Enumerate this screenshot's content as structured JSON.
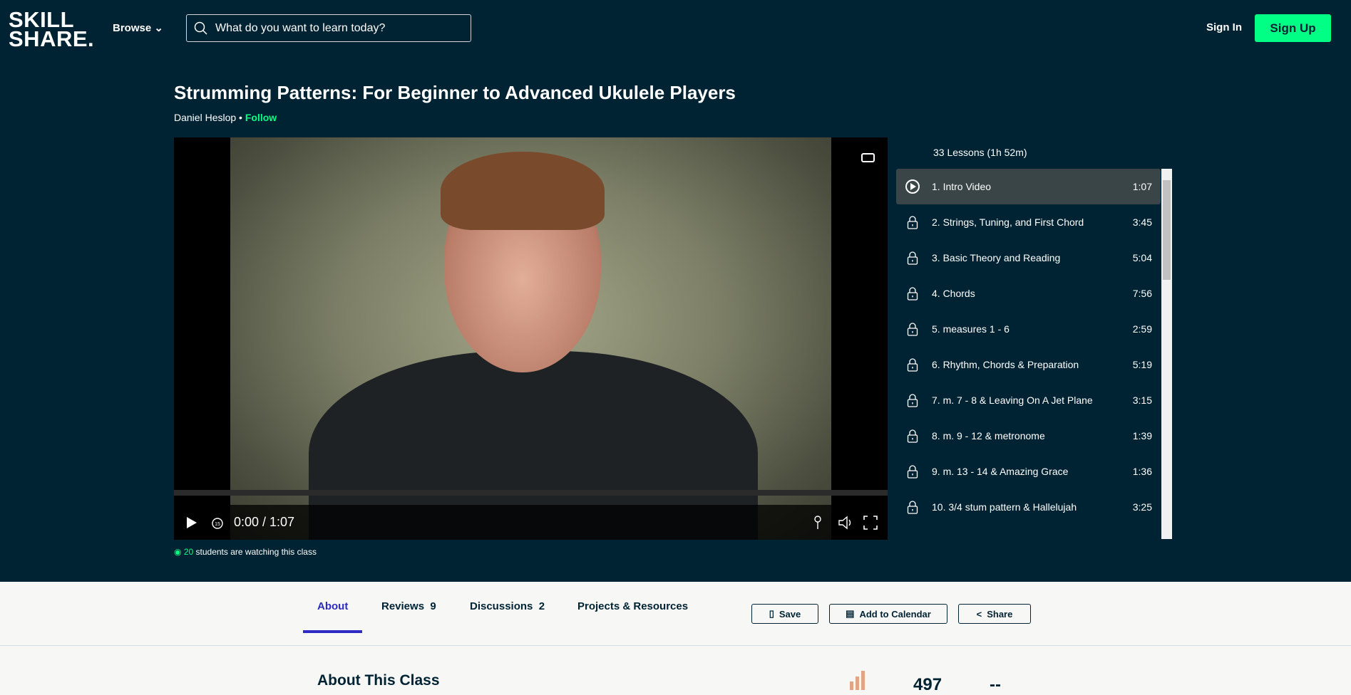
{
  "header": {
    "logo": "SKILL SHARE.",
    "browse": "Browse",
    "search_placeholder": "What do you want to learn today?",
    "sign_in": "Sign In",
    "sign_up": "Sign Up"
  },
  "course": {
    "title": "Strumming Patterns: For Beginner to Advanced Ukulele Players",
    "author": "Daniel Heslop",
    "follow": "Follow"
  },
  "player": {
    "time": "0:00 / 1:07"
  },
  "lessons": {
    "summary": "33 Lessons (1h 52m)",
    "items": [
      {
        "label": "1. Intro Video",
        "duration": "1:07",
        "icon": "play-circle-icon",
        "active": true
      },
      {
        "label": "2. Strings, Tuning, and First Chord",
        "duration": "3:45",
        "icon": "lock-icon"
      },
      {
        "label": "3. Basic Theory and Reading",
        "duration": "5:04",
        "icon": "lock-icon"
      },
      {
        "label": "4. Chords",
        "duration": "7:56",
        "icon": "lock-icon"
      },
      {
        "label": "5. measures 1 - 6",
        "duration": "2:59",
        "icon": "lock-icon"
      },
      {
        "label": "6. Rhythm, Chords & Preparation",
        "duration": "5:19",
        "icon": "lock-icon"
      },
      {
        "label": "7. m. 7 - 8 & Leaving On A Jet Plane",
        "duration": "3:15",
        "icon": "lock-icon"
      },
      {
        "label": "8. m. 9 - 12 & metronome",
        "duration": "1:39",
        "icon": "lock-icon"
      },
      {
        "label": "9. m. 13 - 14 & Amazing Grace",
        "duration": "1:36",
        "icon": "lock-icon"
      },
      {
        "label": "10. 3/4 stum pattern & Hallelujah",
        "duration": "3:25",
        "icon": "lock-icon"
      }
    ]
  },
  "watching": {
    "count": "20",
    "text": " students are watching this class"
  },
  "tabs": [
    {
      "label": "About"
    },
    {
      "label": "Reviews  9"
    },
    {
      "label": "Discussions  2"
    },
    {
      "label": "Projects & Resources"
    }
  ],
  "actions": {
    "save": "Save",
    "calendar": "Add to Calendar",
    "share": "Share"
  },
  "about": {
    "heading": "About This Class",
    "stat1": "497",
    "stat2": "--"
  },
  "colors": {
    "bg_dark": "#002333",
    "accent": "#00ff84",
    "tab_active": "#2d2bc3"
  }
}
